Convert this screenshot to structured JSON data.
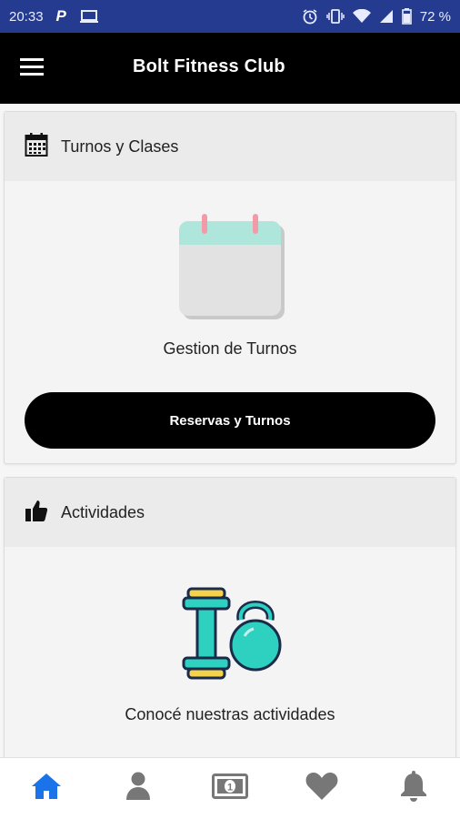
{
  "status_bar": {
    "time": "20:33",
    "battery": "72 %",
    "icons": [
      "parking-icon",
      "laptop-icon",
      "alarm-icon",
      "vibrate-icon",
      "wifi-icon",
      "signal-icon",
      "battery-icon"
    ]
  },
  "app_bar": {
    "title": "Bolt Fitness Club",
    "menu_icon": "hamburger-menu-icon"
  },
  "cards": {
    "turnos": {
      "header_title": "Turnos y Clases",
      "header_icon": "calendar-icon",
      "illustration": "calendar-illustration",
      "caption": "Gestion de Turnos",
      "button_label": "Reservas y Turnos"
    },
    "actividades": {
      "header_title": "Actividades",
      "header_icon": "thumbs-up-icon",
      "illustration": "dumbbell-kettlebell-illustration",
      "caption": "Conocé nuestras actividades"
    }
  },
  "bottom_nav": {
    "items": [
      {
        "icon": "home-icon",
        "active": true
      },
      {
        "icon": "user-icon",
        "active": false
      },
      {
        "icon": "money-icon",
        "active": false
      },
      {
        "icon": "heart-icon",
        "active": false
      },
      {
        "icon": "bell-icon",
        "active": false
      }
    ]
  },
  "colors": {
    "status_bar": "#243b8f",
    "app_bar": "#000000",
    "accent": "#1a73e8",
    "inactive_icon": "#777777",
    "calendar_top": "#aee6dc",
    "dumbbell_teal": "#2ed1c0",
    "dumbbell_yellow": "#f4d24b"
  }
}
